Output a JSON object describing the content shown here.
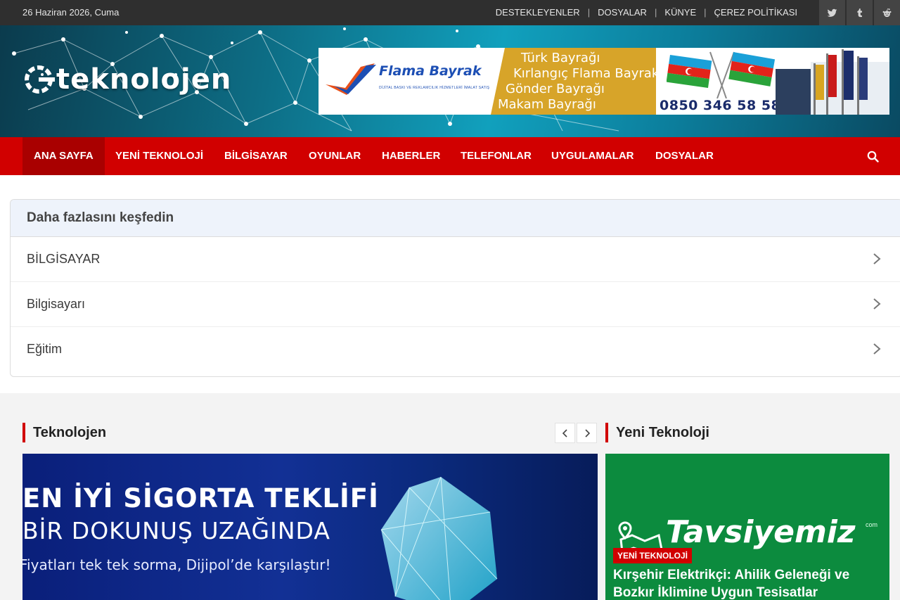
{
  "topbar": {
    "date": "26 Haziran 2026, Cuma",
    "links": [
      "DESTEKLEYENLER",
      "DOSYALAR",
      "KÜNYE",
      "ÇEREZ POLİTİKASI"
    ],
    "social_icons": [
      "twitter-icon",
      "tumblr-icon",
      "reddit-icon"
    ]
  },
  "header": {
    "logo_text": "teknolojen",
    "banner": {
      "brand": "Flama Bayrak",
      "brand_sub": "DİJİTAL BASKI VE REKLAMCILIK HİZMETLERİ İMALAT SATIŞ",
      "lines": [
        "Türk Bayrağı",
        "Kırlangıç Flama Bayrak",
        "Gönder Bayrağı",
        "Makam Bayrağı"
      ],
      "phone": "0850 346 58 58"
    }
  },
  "nav": {
    "items": [
      "ANA SAYFA",
      "YENİ TEKNOLOJİ",
      "BİLGİSAYAR",
      "OYUNLAR",
      "HABERLER",
      "TELEFONLAR",
      "UYGULAMALAR",
      "DOSYALAR"
    ],
    "active_index": 0,
    "search_icon": "search-icon"
  },
  "discover": {
    "title": "Daha fazlasını keşfedin",
    "items": [
      "BİLGİSAYAR",
      "Bilgisayarı",
      "Eğitim"
    ]
  },
  "sections": {
    "main_title": "Teknolojen",
    "side_title": "Yeni Teknoloji"
  },
  "slide": {
    "line1": "EN İYİ SİGORTA TEKLİFİ",
    "line2": "BİR DOKUNUŞ UZAĞINDA",
    "line3": "Fiyatları tek tek sorma, Dijipol’de karşılaştır!"
  },
  "card": {
    "brand": "Tavsiyemiz",
    "brand_suffix": "com",
    "badge": "YENİ TEKNOLOJİ",
    "title": "Kırşehir Elektrikçi: Ahilik Geleneği ve Bozkır İklimine Uygun Tesisatlar"
  },
  "colors": {
    "accent": "#d10000",
    "topbar": "#2f2f2f",
    "card_green": "#0c8b3e"
  }
}
